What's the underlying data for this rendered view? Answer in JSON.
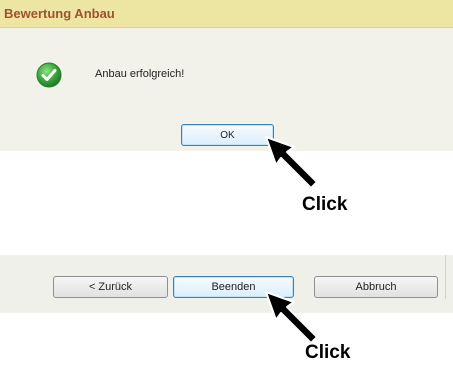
{
  "dialog": {
    "title": "Bewertung Anbau",
    "icon": "check-circle-icon",
    "message": "Anbau erfolgreich!",
    "ok_label": "OK"
  },
  "wizard_footer": {
    "back_label": "< Zurück",
    "finish_label": "Beenden",
    "cancel_label": "Abbruch"
  },
  "annotations": {
    "click_label_1": "Click",
    "click_label_2": "Click"
  },
  "colors": {
    "titlebar_bg": "#ece6a2",
    "title_text": "#a0512f",
    "dialog_bg": "#f2f2ea",
    "check_green": "#3aa83a",
    "default_button_border": "#3c7fb1"
  }
}
